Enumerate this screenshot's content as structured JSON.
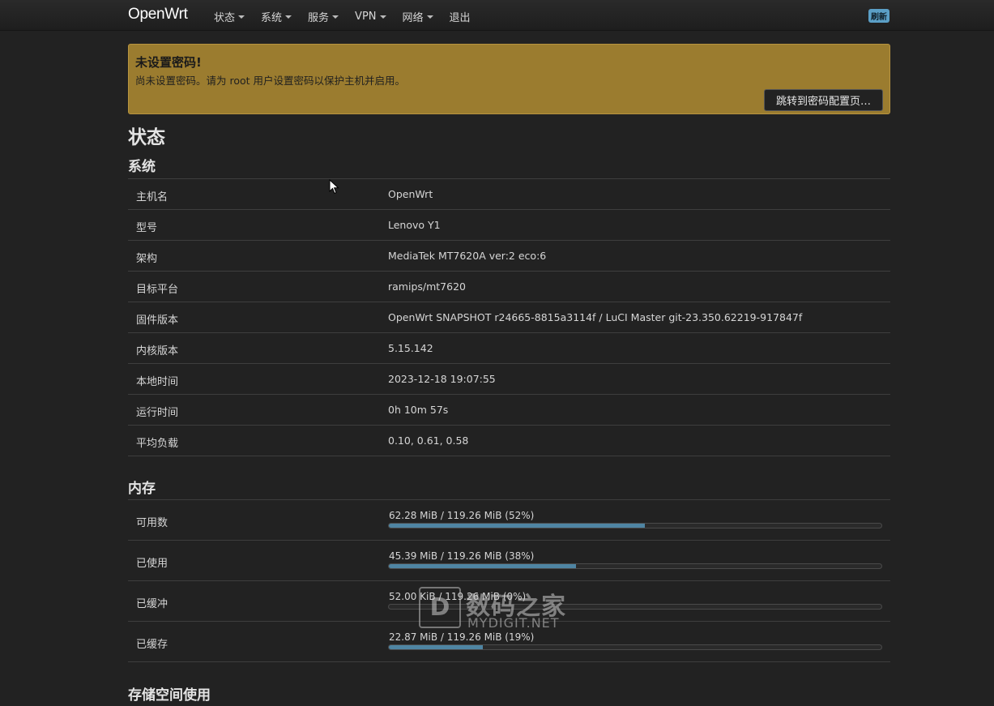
{
  "navbar": {
    "brand": "OpenWrt",
    "menu": [
      {
        "label": "状态",
        "has_dropdown": true
      },
      {
        "label": "系统",
        "has_dropdown": true
      },
      {
        "label": "服务",
        "has_dropdown": true
      },
      {
        "label": "VPN",
        "has_dropdown": true
      },
      {
        "label": "网络",
        "has_dropdown": true
      },
      {
        "label": "退出",
        "has_dropdown": false
      }
    ],
    "refresh_badge": "刷新"
  },
  "alert": {
    "title": "未设置密码!",
    "text": "尚未设置密码。请为 root 用户设置密码以保护主机并启用。",
    "button": "跳转到密码配置页…"
  },
  "page_title": "状态",
  "system": {
    "title": "系统",
    "rows": [
      {
        "label": "主机名",
        "value": "OpenWrt"
      },
      {
        "label": "型号",
        "value": "Lenovo Y1"
      },
      {
        "label": "架构",
        "value": "MediaTek MT7620A ver:2 eco:6"
      },
      {
        "label": "目标平台",
        "value": "ramips/mt7620"
      },
      {
        "label": "固件版本",
        "value": "OpenWrt SNAPSHOT r24665-8815a3114f / LuCI Master git-23.350.62219-917847f"
      },
      {
        "label": "内核版本",
        "value": "5.15.142"
      },
      {
        "label": "本地时间",
        "value": "2023-12-18 19:07:55"
      },
      {
        "label": "运行时间",
        "value": "0h 10m 57s"
      },
      {
        "label": "平均负载",
        "value": "0.10, 0.61, 0.58"
      }
    ]
  },
  "memory": {
    "title": "内存",
    "rows": [
      {
        "label": "可用数",
        "value": "62.28 MiB / 119.26 MiB (52%)",
        "percent": 52
      },
      {
        "label": "已使用",
        "value": "45.39 MiB / 119.26 MiB (38%)",
        "percent": 38
      },
      {
        "label": "已缓冲",
        "value": "52.00 KiB / 119.26 MiB (0%)",
        "percent": 0
      },
      {
        "label": "已缓存",
        "value": "22.87 MiB / 119.26 MiB (19%)",
        "percent": 19
      }
    ]
  },
  "storage": {
    "title": "存储空间使用"
  },
  "watermark": {
    "logo_letter": "D",
    "cn": "数码之家",
    "en": "MYDIGIT.NET"
  },
  "colors": {
    "background": "#222222",
    "alert": "#9b7c2f",
    "progress": "#4f85a3",
    "badge": "#5b9fc6"
  }
}
